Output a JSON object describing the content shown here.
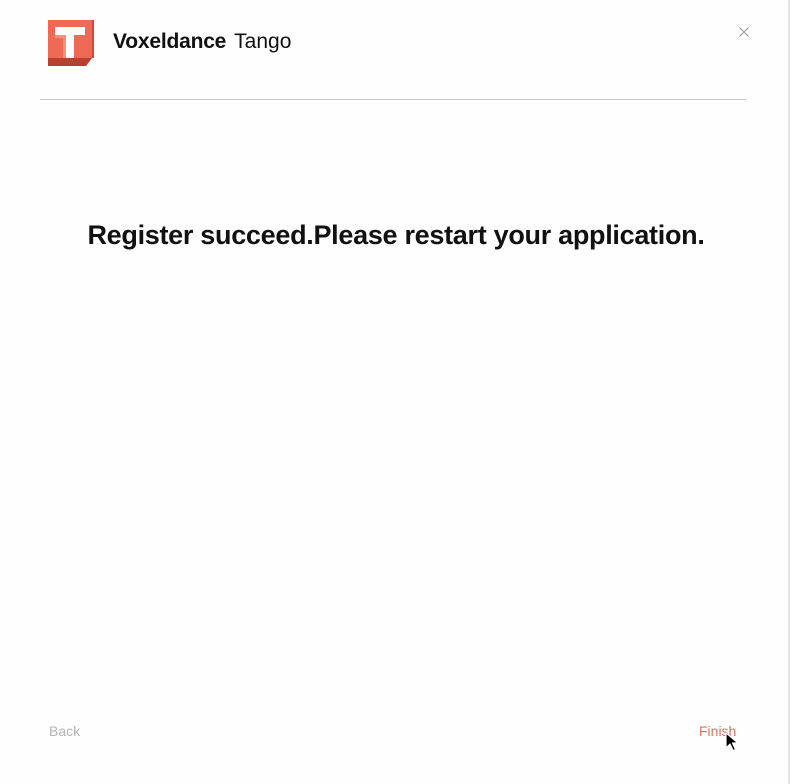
{
  "header": {
    "brand_name": "Voxeldance",
    "product_name": "Tango",
    "logo_icon": "tango-logo-icon",
    "close_icon": "close-icon"
  },
  "main": {
    "message": "Register succeed.Please restart your application."
  },
  "footer": {
    "back_label": "Back",
    "finish_label": "Finish"
  },
  "colors": {
    "accent": "#d77562",
    "logo_light": "#ef6a54",
    "logo_dark": "#b8402f",
    "disabled": "#b3b3b3"
  }
}
